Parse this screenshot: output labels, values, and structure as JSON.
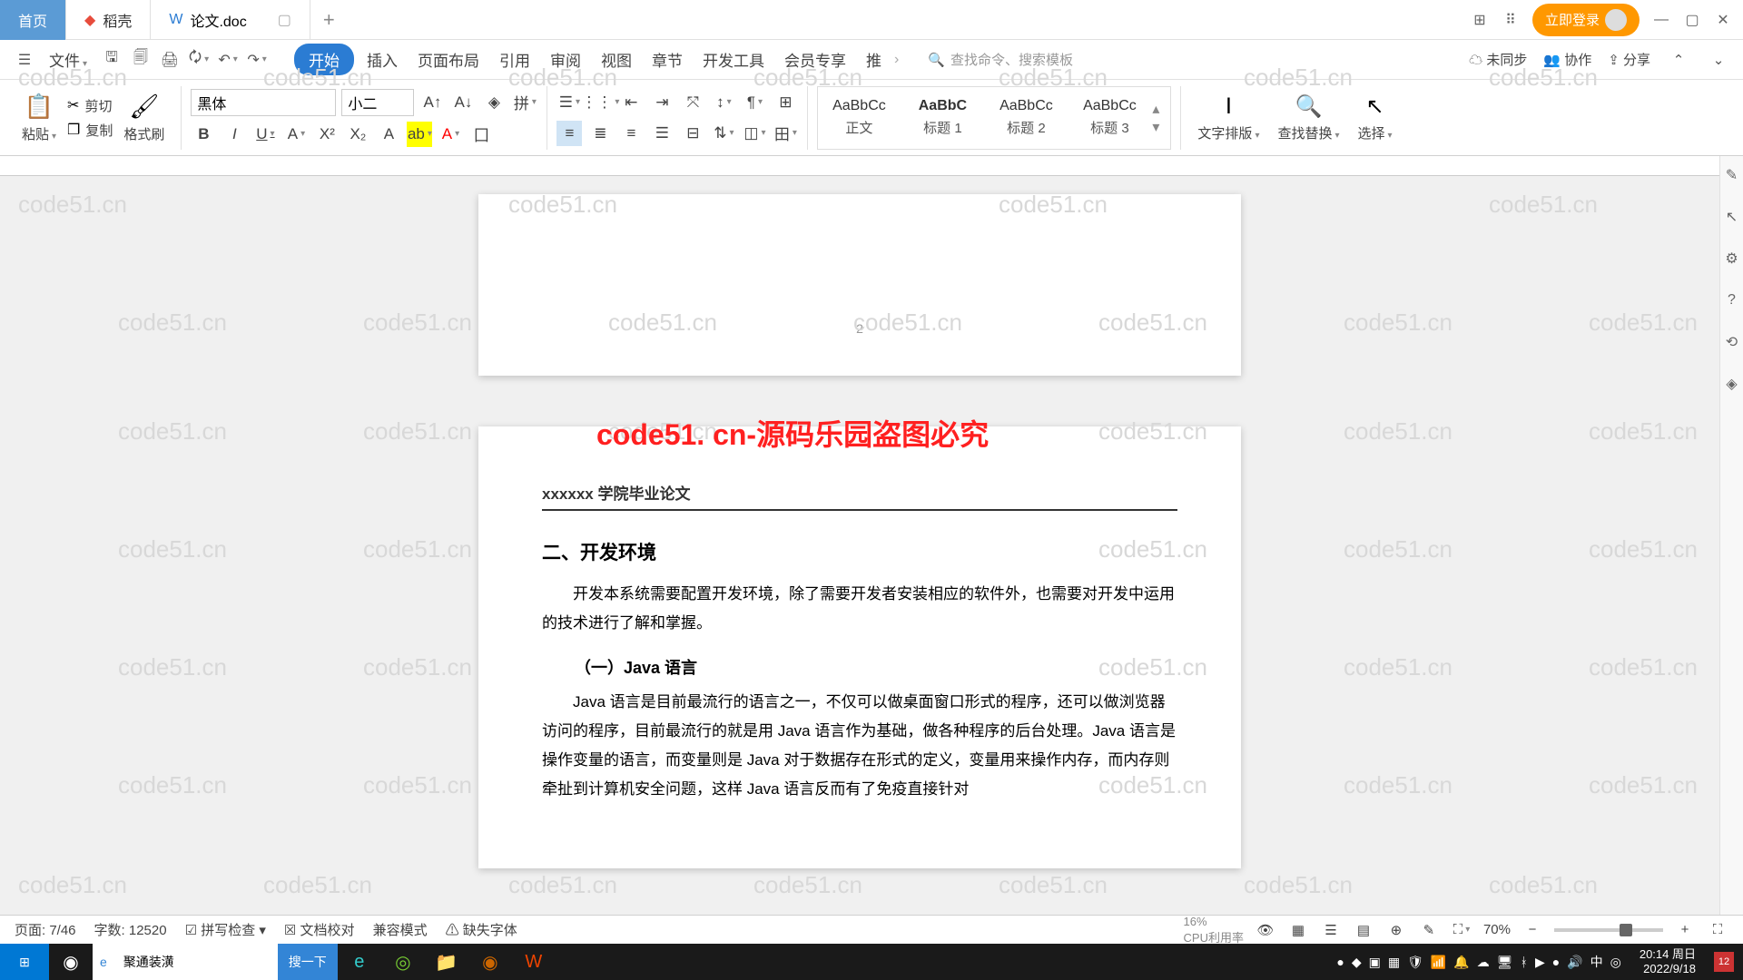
{
  "tabs": {
    "home": "首页",
    "dk": "稻壳",
    "doc": "论文.doc"
  },
  "title_right": {
    "login": "立即登录"
  },
  "menubar": {
    "file": "文件",
    "items": [
      "开始",
      "插入",
      "页面布局",
      "引用",
      "审阅",
      "视图",
      "章节",
      "开发工具",
      "会员专享",
      "推"
    ],
    "search_ph": "查找命令、搜索模板",
    "sync": "未同步",
    "collab": "协作",
    "share": "分享"
  },
  "ribbon": {
    "paste": "粘贴",
    "cut": "剪切",
    "copy": "复制",
    "format": "格式刷",
    "font": "黑体",
    "size": "小二",
    "styles": [
      {
        "prev": "AaBbCc",
        "name": "正文"
      },
      {
        "prev": "AaBbC",
        "name": "标题 1"
      },
      {
        "prev": "AaBbCc",
        "name": "标题 2"
      },
      {
        "prev": "AaBbCc",
        "name": "标题 3"
      }
    ],
    "textdir": "文字排版",
    "findrep": "查找替换",
    "select": "选择"
  },
  "doc": {
    "page_num_top": "2",
    "header": "xxxxxx 学院毕业论文",
    "wm_red": "code51. cn-源码乐园盗图必究",
    "h2": "二、开发环境",
    "p1": "开发本系统需要配置开发环境，除了需要开发者安装相应的软件外，也需要对开发中运用的技术进行了解和掌握。",
    "h3": "（一）Java 语言",
    "p2": "Java 语言是目前最流行的语言之一，不仅可以做桌面窗口形式的程序，还可以做浏览器访问的程序，目前最流行的就是用 Java 语言作为基础，做各种程序的后台处理。Java 语言是操作变量的语言，而变量则是 Java 对于数据存在形式的定义，变量用来操作内存，而内存则牵扯到计算机安全问题，这样 Java 语言反而有了免疫直接针对"
  },
  "status": {
    "page": "页面: 7/46",
    "words": "字数: 12520",
    "spell": "拼写检查",
    "proof": "文档校对",
    "compat": "兼容模式",
    "missing": "缺失字体",
    "zoom": "70%",
    "cpu": "CPU利用率",
    "cpu2": "16%"
  },
  "taskbar": {
    "search_val": "聚通装潢",
    "search_btn": "搜一下",
    "time": "20:14 周日",
    "date": "2022/9/18"
  },
  "watermark": "code51.cn"
}
